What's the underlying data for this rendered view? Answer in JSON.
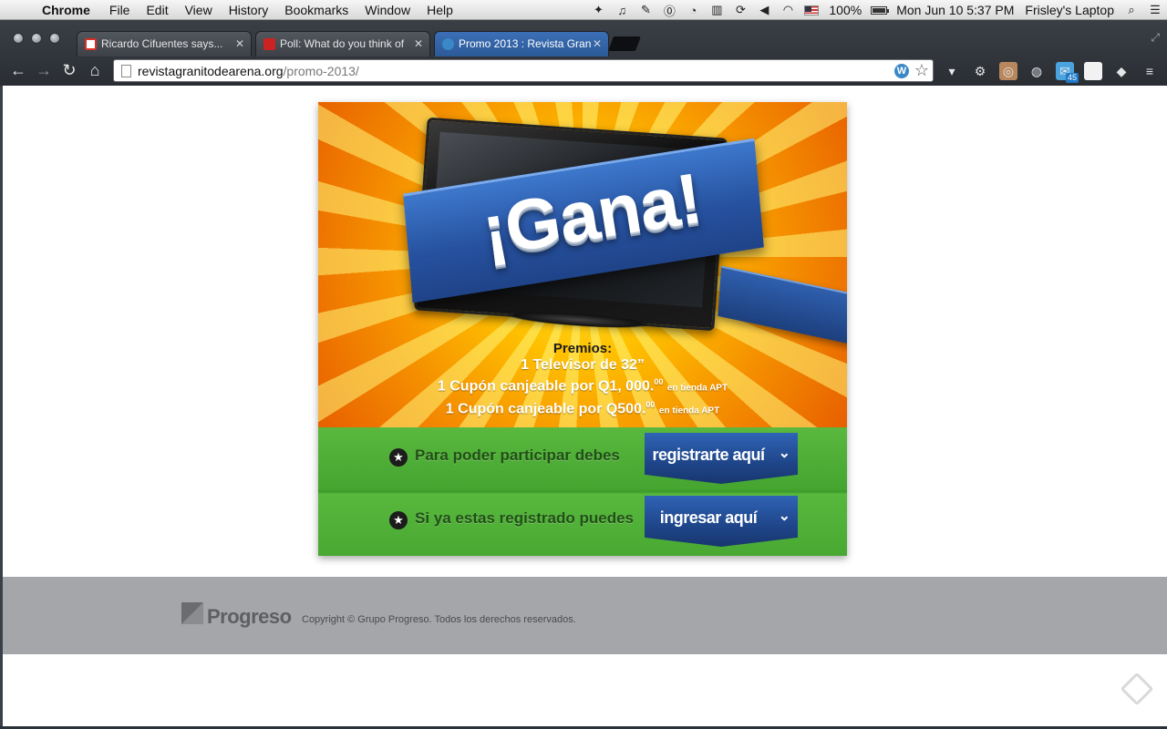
{
  "menubar": {
    "app": "Chrome",
    "menus": [
      "File",
      "Edit",
      "View",
      "History",
      "Bookmarks",
      "Window",
      "Help"
    ],
    "battery": "100%",
    "datetime": "Mon Jun 10  5:37 PM",
    "user": "Frisley's Laptop"
  },
  "tabs": [
    {
      "title": "Ricardo Cifuentes says...",
      "favicon_color": "#d93025"
    },
    {
      "title": "Poll: What do you think of",
      "favicon_color": "#cc2222"
    },
    {
      "title": "Promo 2013 : Revista Gran",
      "favicon_color": "#3a88c7"
    }
  ],
  "omnibox": {
    "domain": "revistagranitodearena.org",
    "path": "/promo-2013/"
  },
  "extensions": {
    "twitter_count": "45"
  },
  "promo": {
    "title": "¡Gana!",
    "prizes_heading": "Premios:",
    "prize_1": "1 Televisor de 32”",
    "prize_2_main": "1 Cupón canjeable por Q1, 000.",
    "prize_2_sup": "00",
    "prize_2_store": "en tienda APT",
    "prize_3_main": "1 Cupón canjeable por Q500.",
    "prize_3_sup": "00",
    "prize_3_store": "en tienda APT",
    "register_text": "Para poder participar debes",
    "register_button": "registrarte aquí",
    "login_text": "Si ya estas registrado puedes",
    "login_button": "ingresar aquí"
  },
  "footer": {
    "brand": "Progreso",
    "copyright": "Copyright © Grupo Progreso. Todos los derechos reservados."
  },
  "colors": {
    "banner_orange": "#f59000",
    "cta_green": "#45a530",
    "ribbon_blue": "#2752a0",
    "footer_gray": "#a5a6aa"
  }
}
